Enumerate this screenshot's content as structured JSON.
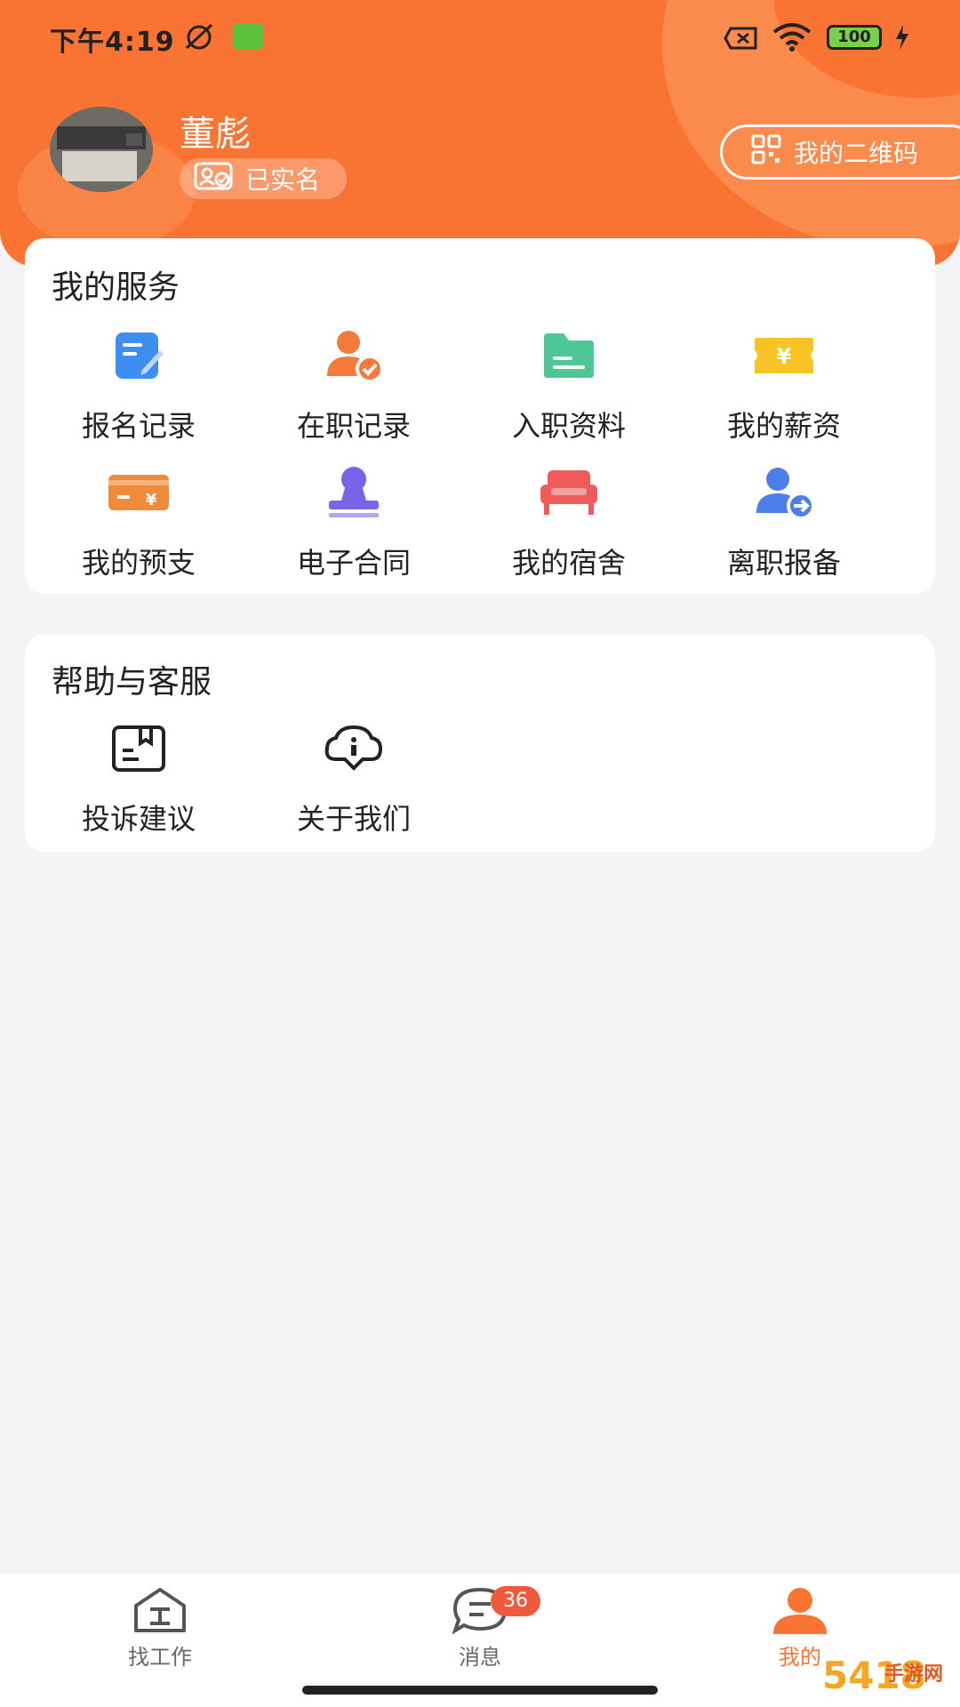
{
  "status_bar": {
    "time": "下午4:19",
    "battery": "100"
  },
  "profile": {
    "name": "董彪",
    "verified_label": "已实名",
    "qr_label": "我的二维码"
  },
  "services": {
    "title": "我的服务",
    "items": [
      {
        "label": "报名记录",
        "icon": "edit-document-icon",
        "color": "#3d8ef0"
      },
      {
        "label": "在职记录",
        "icon": "person-check-icon",
        "color": "#f5793a"
      },
      {
        "label": "入职资料",
        "icon": "folder-icon",
        "color": "#4cc795"
      },
      {
        "label": "我的薪资",
        "icon": "yen-ticket-icon",
        "color": "#f7c325"
      },
      {
        "label": "我的预支",
        "icon": "card-yen-icon",
        "color": "#f08b3c"
      },
      {
        "label": "电子合同",
        "icon": "stamp-icon",
        "color": "#7a63e8"
      },
      {
        "label": "我的宿舍",
        "icon": "bed-icon",
        "color": "#ef5a5a"
      },
      {
        "label": "离职报备",
        "icon": "person-exit-icon",
        "color": "#4b7ee8"
      }
    ]
  },
  "help": {
    "title": "帮助与客服",
    "items": [
      {
        "label": "投诉建议",
        "icon": "complaint-icon"
      },
      {
        "label": "关于我们",
        "icon": "info-bubble-icon"
      }
    ]
  },
  "tabbar": {
    "tabs": [
      {
        "label": "找工作",
        "icon": "house-icon",
        "active": false
      },
      {
        "label": "消息",
        "icon": "chat-icon",
        "active": false,
        "badge": "36"
      },
      {
        "label": "我的",
        "icon": "person-icon",
        "active": true
      }
    ]
  },
  "watermark": {
    "main": "5418",
    "sub": "手游网"
  }
}
